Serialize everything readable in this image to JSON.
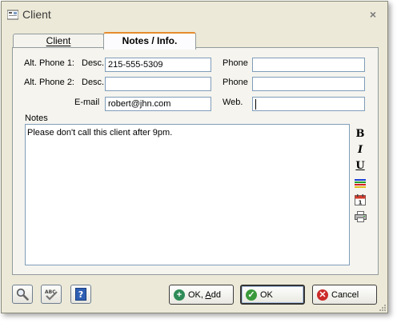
{
  "window": {
    "title": "Client",
    "close_glyph": "×"
  },
  "tabs": [
    {
      "label": "Client",
      "active": false
    },
    {
      "label": "Notes / Info.",
      "active": true
    }
  ],
  "alt_phone_1": {
    "label": "Alt. Phone 1:",
    "desc_label": "Desc.",
    "desc_value": "215-555-5309",
    "phone_label": "Phone",
    "phone_value": ""
  },
  "alt_phone_2": {
    "label": "Alt. Phone 2:",
    "desc_label": "Desc.",
    "desc_value": "",
    "phone_label": "Phone",
    "phone_value": ""
  },
  "email": {
    "label": "E-mail",
    "value": "robert@jhn.com"
  },
  "web": {
    "label": "Web.",
    "value": ""
  },
  "notes": {
    "label": "Notes",
    "value": "Please don't call this client after 9pm."
  },
  "format_toolbar": [
    {
      "name": "bold-button",
      "glyph": "B"
    },
    {
      "name": "italic-button",
      "glyph": "I"
    },
    {
      "name": "underline-button",
      "glyph": "U"
    },
    {
      "name": "color-button",
      "icon": "color-lines-icon"
    },
    {
      "name": "date-button",
      "icon": "calendar-icon",
      "glyph": "1"
    },
    {
      "name": "print-button",
      "icon": "printer-icon"
    }
  ],
  "bottom_buttons": {
    "search_icon": "magnifier-icon",
    "spellcheck_icon": "spellcheck-icon",
    "spellcheck_glyph": "ABC",
    "help_icon": "help-icon",
    "help_glyph": "?",
    "ok_add": {
      "label_prefix": "OK, ",
      "label_accel": "A",
      "label_rest": "dd",
      "icon": "plus-circle-icon"
    },
    "ok": {
      "label": "OK",
      "icon": "check-circle-icon"
    },
    "cancel": {
      "label": "Cancel",
      "icon": "x-circle-icon"
    }
  },
  "colors": {
    "accent_tab": "#e68b2c",
    "ok_green": "#3a9a3a",
    "cancel_red": "#cc2a2a",
    "add_green": "#2e8b57",
    "field_border": "#7f9db9"
  }
}
